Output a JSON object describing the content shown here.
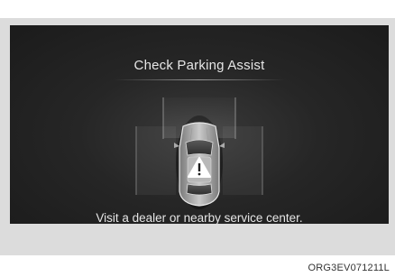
{
  "display": {
    "title": "Check Parking Assist",
    "message": "Visit a dealer or nearby service center."
  },
  "image_code": "ORG3EV071211L",
  "icons": {
    "warning": "warning-triangle-icon",
    "vehicle": "car-top-view-icon"
  },
  "colors": {
    "screen_bg": "#1b1b1b",
    "text": "#e6e6e6",
    "frame": "#dcdcdc"
  }
}
